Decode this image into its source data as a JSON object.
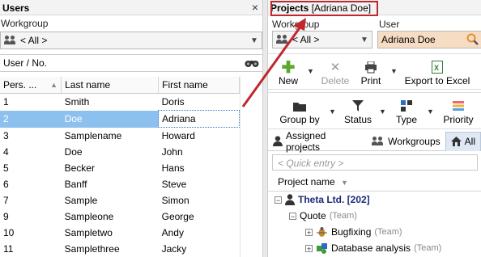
{
  "left": {
    "title": "Users",
    "close_glyph": "×",
    "workgroup_label": "Workgroup",
    "workgroup_value": "< All >",
    "search_label": "User / No.",
    "columns": [
      "Pers. ...",
      "Last name",
      "First name"
    ],
    "rows": [
      {
        "no": "1",
        "last": "Smith",
        "first": "Doris"
      },
      {
        "no": "2",
        "last": "Doe",
        "first": "Adriana"
      },
      {
        "no": "3",
        "last": "Samplename",
        "first": "Howard"
      },
      {
        "no": "4",
        "last": "Doe",
        "first": "John"
      },
      {
        "no": "5",
        "last": "Becker",
        "first": "Hans"
      },
      {
        "no": "6",
        "last": "Banff",
        "first": "Steve"
      },
      {
        "no": "7",
        "last": "Sample",
        "first": "Simon"
      },
      {
        "no": "9",
        "last": "Sampleone",
        "first": "George"
      },
      {
        "no": "10",
        "last": "Sampletwo",
        "first": "Andy"
      },
      {
        "no": "11",
        "last": "Samplethree",
        "first": "Jacky"
      }
    ],
    "selected_index": 1
  },
  "right": {
    "title": "Projects",
    "title_suffix": "[Adriana Doe]",
    "workgroup_label": "Workgroup",
    "workgroup_value": "< All >",
    "user_label": "User",
    "user_value": "Adriana Doe",
    "toolbar1": {
      "new": "New",
      "delete": "Delete",
      "print": "Print",
      "export": "Export to Excel"
    },
    "toolbar2": {
      "group_by": "Group by",
      "status": "Status",
      "type": "Type",
      "priority": "Priority"
    },
    "tabs": {
      "assigned": "Assigned projects",
      "workgroups": "Workgroups",
      "all": "All"
    },
    "quick_entry": "< Quick entry >",
    "col_project": "Project name",
    "tree": {
      "customer": "Theta Ltd. [202]",
      "group": "Quote",
      "group_tag": "(Team)",
      "items": [
        {
          "name": "Bugfixing",
          "tag": "(Team)"
        },
        {
          "name": "Database analysis",
          "tag": "(Team)"
        }
      ]
    }
  },
  "colors": {
    "selection": "#8cc0ee",
    "annotation": "#c0282d",
    "user_field": "#f7dcc4"
  }
}
